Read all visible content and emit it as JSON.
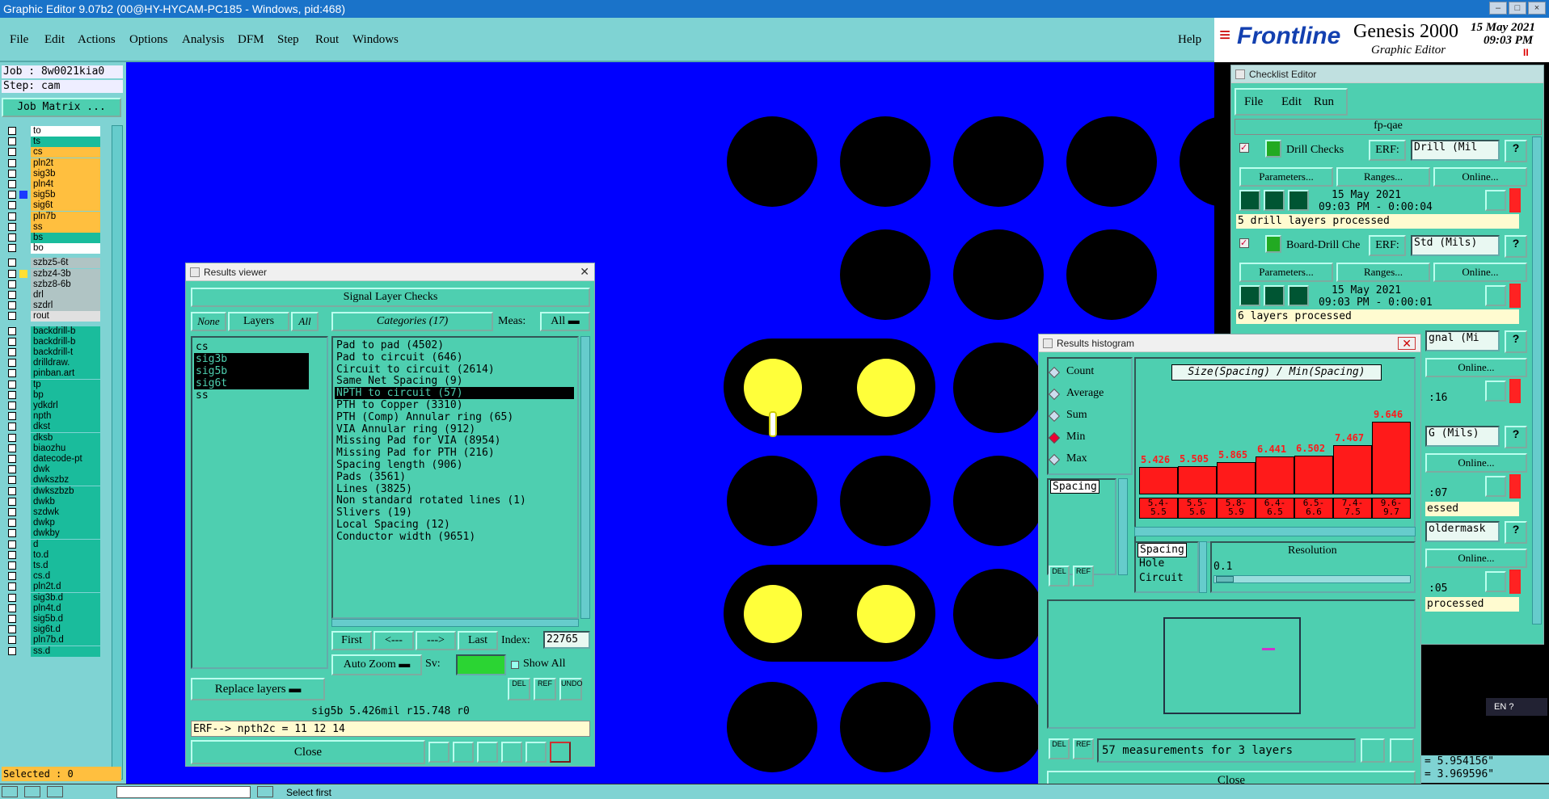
{
  "window": {
    "title": "Graphic Editor 9.07b2 (00@HY-HYCAM-PC185 - Windows, pid:468)"
  },
  "menu": {
    "file": "File",
    "edit": "Edit",
    "actions": "Actions",
    "options": "Options",
    "analysis": "Analysis",
    "dfm": "DFM",
    "step": "Step",
    "rout": "Rout",
    "windows": "Windows",
    "help": "Help"
  },
  "brand": {
    "logo": "Frontline",
    "product": "Genesis 2000",
    "sub": "Graphic Editor",
    "date": "15 May 2021",
    "time": "09:03 PM",
    "pause": "II"
  },
  "job": {
    "job": "Job : 8w0021kia0",
    "step": "Step: cam",
    "matrix": "Job Matrix ..."
  },
  "layers_a": [
    {
      "n": "to",
      "c": "#ffffff"
    },
    {
      "n": "ts",
      "c": "#1abc9c"
    },
    {
      "n": "cs",
      "c": "#ffbf3f"
    },
    {
      "n": "pln2t",
      "c": "#ffbf3f"
    },
    {
      "n": "sig3b",
      "c": "#ffbf3f"
    },
    {
      "n": "pln4t",
      "c": "#ffbf3f"
    },
    {
      "n": "sig5b",
      "c": "#ffbf3f"
    },
    {
      "n": "sig6t",
      "c": "#ffbf3f"
    },
    {
      "n": "pln7b",
      "c": "#ffbf3f"
    },
    {
      "n": "ss",
      "c": "#ffbf3f"
    },
    {
      "n": "bs",
      "c": "#1abc9c"
    },
    {
      "n": "bo",
      "c": "#ffffff"
    }
  ],
  "layers_b": [
    {
      "n": "szbz5-6t",
      "c": "#b0c4c4"
    },
    {
      "n": "szbz4-3b",
      "c": "#b0c4c4"
    },
    {
      "n": "szbz8-6b",
      "c": "#b0c4c4"
    },
    {
      "n": "drl",
      "c": "#b0c4c4"
    },
    {
      "n": "szdrl",
      "c": "#b0c4c4"
    },
    {
      "n": "rout",
      "c": "#e0e0e0"
    }
  ],
  "layers_c": [
    "backdrill-b",
    "backdrill-b",
    "backdrill-t",
    "drilldraw.",
    "pinban.art",
    "tp",
    "bp",
    "ydkdrl",
    "npth",
    "dkst",
    "dksb",
    "biaozhu",
    "datecode-pt",
    "dwk",
    "dwkszbz",
    "dwkszbzb",
    "dwkb",
    "szdwk",
    "dwkp",
    "dwkby",
    "d",
    "to.d",
    "ts.d",
    "cs.d",
    "pln2t.d",
    "sig3b.d",
    "pln4t.d",
    "sig5b.d",
    "sig6t.d",
    "pln7b.d",
    "ss.d"
  ],
  "selected": "Selected : 0",
  "results": {
    "title": "Results viewer",
    "header": "Signal Layer Checks",
    "none": "None",
    "layers": "Layers",
    "all": "All",
    "categories": "Categories (17)",
    "meas": "Meas:",
    "meas_val": "All",
    "layer_list": [
      "cs",
      "sig3b",
      "sig5b",
      "sig6t",
      "ss"
    ],
    "cats": [
      "Pad to pad (4502)",
      "Pad to circuit (646)",
      "Circuit to circuit (2614)",
      "Same Net Spacing (9)",
      "NPTH to circuit (57)",
      "PTH to Copper (3310)",
      "PTH (Comp) Annular ring (65)",
      "VIA Annular ring (912)",
      "Missing Pad for VIA (8954)",
      "Missing Pad for PTH (216)",
      "Spacing length (906)",
      "Pads (3561)",
      "Lines (3825)",
      "Non standard rotated lines (1)",
      "Slivers (19)",
      "Local Spacing (12)",
      "Conductor width (9651)"
    ],
    "first": "First",
    "prev": "<---",
    "next": "--->",
    "last": "Last",
    "index_label": "Index:",
    "index": "22765",
    "autozoom": "Auto Zoom",
    "sv": "Sv:",
    "showall": "Show All",
    "replace": "Replace layers",
    "del": "DEL",
    "ref": "REF",
    "undo": "UNDO",
    "info": "sig5b 5.426mil  r15.748  r0",
    "erf": "ERF--> npth2c = 11 12 14",
    "close": "Close"
  },
  "checklist": {
    "title": "Checklist Editor",
    "file": "File",
    "edit": "Edit",
    "run": "Run",
    "name": "fp-qae",
    "c1": {
      "name": "Drill Checks",
      "erf": "ERF:",
      "erfval": "Drill (Mil",
      "params": "Parameters...",
      "ranges": "Ranges...",
      "online": "Online...",
      "date": "15 May 2021",
      "time": "09:03 PM - 0:00:04",
      "msg": "5 drill layers processed"
    },
    "c2": {
      "name": "Board-Drill Che",
      "erf": "ERF:",
      "erfval": "Std (Mils)",
      "params": "Parameters...",
      "ranges": "Ranges...",
      "online": "Online...",
      "date": "15 May 2021",
      "time": "09:03 PM - 0:00:01",
      "msg": "6 layers processed"
    },
    "c3": {
      "erfval": "gnal (Mi",
      "online": "Online...",
      "time": ":16"
    },
    "c4": {
      "erfval": "G (Mils)",
      "online": "Online...",
      "time": ":07",
      "msg": "essed"
    },
    "c5": {
      "erfval": "oldermask",
      "online": "Online...",
      "time": ":05",
      "msg": "processed"
    }
  },
  "histogram": {
    "title": "Results histogram",
    "count": "Count",
    "average": "Average",
    "sum": "Sum",
    "min": "Min",
    "max": "Max",
    "list": "Spacing",
    "chart_title": "Size(Spacing) / Min(Spacing)",
    "types": [
      "Spacing",
      "Hole",
      "Circuit"
    ],
    "resolution": "Resolution",
    "resval": "0.1",
    "summary": "57 measurements for 3 layers",
    "close": "Close",
    "del": "DEL",
    "ref": "REF"
  },
  "chart_data": {
    "type": "bar",
    "title": "Size(Spacing) / Min(Spacing)",
    "categories": [
      "5.4-5.5",
      "5.5-5.6",
      "5.8-5.9",
      "6.4-6.5",
      "6.5-6.6",
      "7.4-7.5",
      "9.6-9.7"
    ],
    "values": [
      5.426,
      5.505,
      5.865,
      6.441,
      6.502,
      7.467,
      9.646
    ],
    "labels": [
      "5.426",
      "5.505",
      "5.865",
      "6.441",
      "6.502",
      "7.467",
      "9.646"
    ]
  },
  "coords": {
    "x": "= 5.954156\"",
    "y": "= 3.969596\""
  },
  "statusbar": {
    "hint": "Select first"
  },
  "tray": {
    "lang": "EN"
  }
}
